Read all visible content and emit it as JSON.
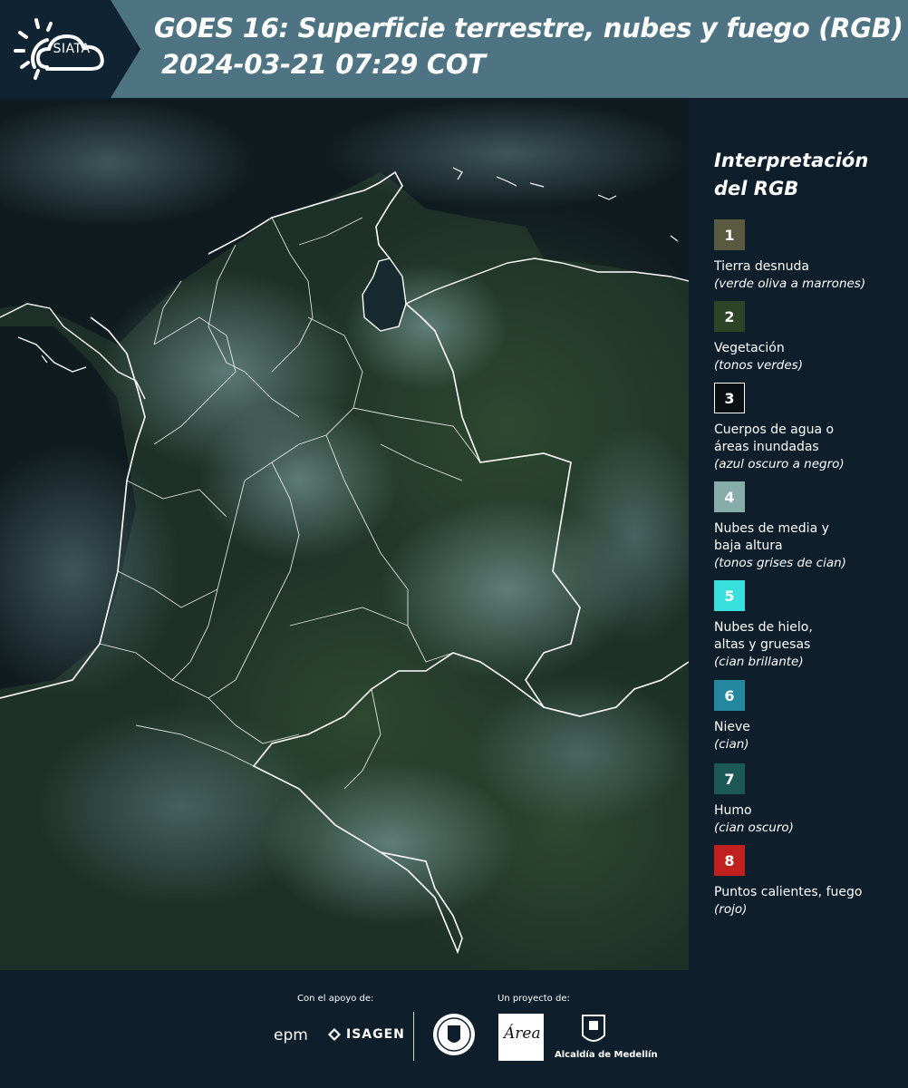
{
  "header": {
    "logo_text": "SIATA",
    "title_line1": "GOES 16: Superficie terrestre, nubes y fuego (RGB)",
    "title_line2": "2024-03-21 07:29 COT"
  },
  "map": {
    "layer": "GOES 16 RGB",
    "boundary_color": "#ffffff"
  },
  "legend": {
    "title": "Interpretación del RGB",
    "items": [
      {
        "number": "1",
        "label": "Tierra desnuda",
        "sub": "(verde oliva a marrones)",
        "color": "#5a5a40"
      },
      {
        "number": "2",
        "label": "Vegetación",
        "sub": "(tonos verdes)",
        "color": "#2d4426"
      },
      {
        "number": "3",
        "label": "Cuerpos de agua o\náreas inundadas",
        "sub": "(azul oscuro a negro)",
        "color": "#0a0f14"
      },
      {
        "number": "4",
        "label": "Nubes de media y\nbaja altura",
        "sub": "(tonos grises de cian)",
        "color": "#86adaa"
      },
      {
        "number": "5",
        "label": "Nubes de hielo,\naltas y gruesas",
        "sub": "(cian brillante)",
        "color": "#37e0dc"
      },
      {
        "number": "6",
        "label": "Nieve",
        "sub": "(cian)",
        "color": "#23889f"
      },
      {
        "number": "7",
        "label": "Humo",
        "sub": "(cian oscuro)",
        "color": "#1d5858"
      },
      {
        "number": "8",
        "label": "Puntos calientes, fuego",
        "sub": "(rojo)",
        "color": "#c1211e"
      }
    ]
  },
  "footer": {
    "support_caption": "Con el apoyo de:",
    "project_caption": "Un proyecto de:",
    "sponsors": [
      "epm",
      "ISAGEN"
    ],
    "partners": [
      "Área Metropolitana Valle de Aburrá",
      "Alcaldía de Medellín"
    ],
    "epm_text": "epm",
    "isagen_text": "ISAGEN",
    "area_text": "Área",
    "alcaldia_text": "Alcaldía de Medellín"
  }
}
